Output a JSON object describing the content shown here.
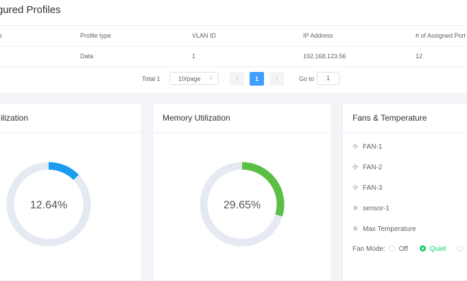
{
  "profiles": {
    "title": "gured Profiles",
    "columns": [
      "e",
      "Profile type",
      "VLAN ID",
      "IP Address",
      "# of Assigned Port"
    ],
    "rows": [
      [
        "",
        "Data",
        "1",
        "192.168.123.56",
        "12"
      ]
    ]
  },
  "pagination": {
    "total_label": "Total 1",
    "page_size": "10/page",
    "current_page": "1",
    "goto_label": "Go to",
    "goto_value": "1"
  },
  "cpu": {
    "title": "ilization",
    "percent_label": "12.64%",
    "percent": 12.64,
    "color": "#1a9bf0"
  },
  "memory": {
    "title": "Memory Utilization",
    "percent_label": "29.65%",
    "percent": 29.65,
    "color": "#5bbf45"
  },
  "fans": {
    "title": "Fans & Temperature",
    "items": [
      {
        "icon": "fan-icon",
        "label": "FAN-1"
      },
      {
        "icon": "fan-icon",
        "label": "FAN-2"
      },
      {
        "icon": "fan-icon",
        "label": "FAN-3"
      },
      {
        "icon": "thermometer-icon",
        "label": "sensor-1"
      },
      {
        "icon": "thermometer-icon",
        "label": "Max Temperature"
      }
    ],
    "mode_label": "Fan Mode:",
    "modes": [
      {
        "label": "Off",
        "selected": false
      },
      {
        "label": "Quiet",
        "selected": true
      }
    ]
  },
  "colors": {
    "accent": "#409eff",
    "track": "#e4e9f2",
    "selected": "#13ce66"
  }
}
